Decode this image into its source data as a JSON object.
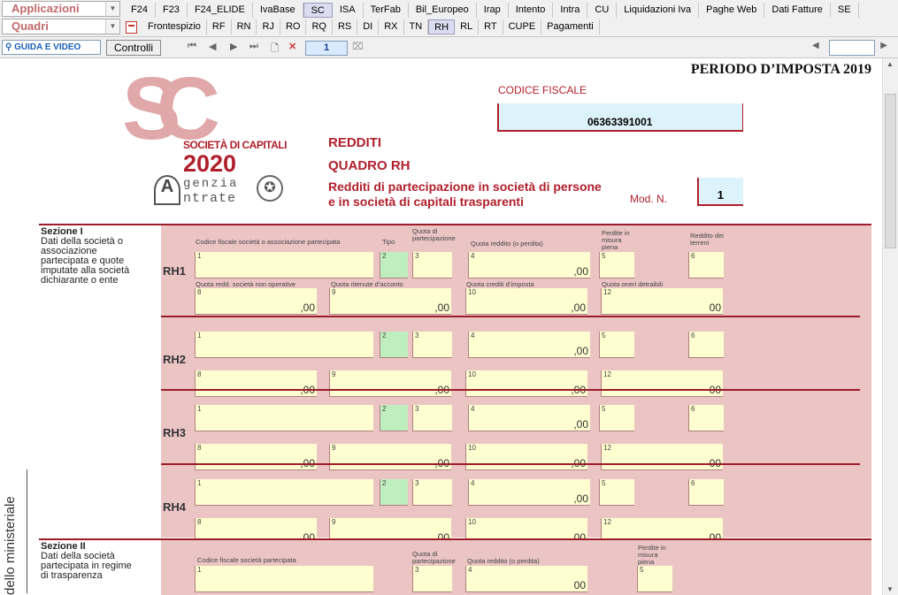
{
  "toolbar": {
    "applicazioni": "Applicazioni",
    "quadri": "Quadri",
    "tabs_top": [
      "F24",
      "F23",
      "F24_ELIDE",
      "IvaBase",
      "SC",
      "ISA",
      "TerFab",
      "Bil_Europeo",
      "Irap",
      "Intento",
      "Intra",
      "CU",
      "Liquidazioni Iva",
      "Paghe Web",
      "Dati Fatture",
      "SE"
    ],
    "tabs_bottom": [
      "Frontespizio",
      "RF",
      "RN",
      "RJ",
      "RO",
      "RQ",
      "RS",
      "DI",
      "RX",
      "TN",
      "RH",
      "RL",
      "RT",
      "CUPE",
      "Pagamenti"
    ],
    "active_top": "SC",
    "active_bottom": "RH",
    "guida": "GUIDA E VIDEO",
    "controlli": "Controlli",
    "page": "1"
  },
  "form": {
    "periodo": "PERIODO D’IMPOSTA 2019",
    "logo_sc": "SC",
    "logo_societa": "SOCIETÀ DI CAPITALI",
    "logo_year": "2020",
    "logo_agenzia": "genzia",
    "logo_entrate": "ntrate",
    "cf_label": "CODICE FISCALE",
    "cf_value": "06363391001",
    "redditi": "REDDITI",
    "quadro": "QUADRO RH",
    "subtitle1": "Redditi di partecipazione in società di persone",
    "subtitle2": "e in società di capitali trasparenti",
    "mod_label": "Mod. N.",
    "mod_value": "1",
    "sez1_title": "Sezione I",
    "sez1_desc": "Dati della società o associazione partecipata e quote imputate alla società dichiarante o ente",
    "sez2_title": "Sezione II",
    "sez2_desc": "Dati della società partecipata in regime di trasparenza",
    "h_cf": "Codice fiscale società o associazione partecipata",
    "h_tipo": "Tipo",
    "h_quota_part": "Quota di partecipazione",
    "h_quota_redd": "Quota reddito (o perdita)",
    "h_perdite": "Perdite in misura piena",
    "h_terreni": "Reddito dei terreni",
    "h_non_op": "Quota redd. società non operative",
    "h_ritenute": "Quota ritenute d’acconto",
    "h_crediti": "Quota crediti d’imposta",
    "h_oneri": "Quota oneri detraibili",
    "h2_cf": "Codice fiscale società partecipata",
    "side_text": "dello ministeriale",
    "rows": [
      "RH1",
      "RH2",
      "RH3",
      "RH4"
    ],
    "dec": ",00",
    "dec2": "00"
  }
}
